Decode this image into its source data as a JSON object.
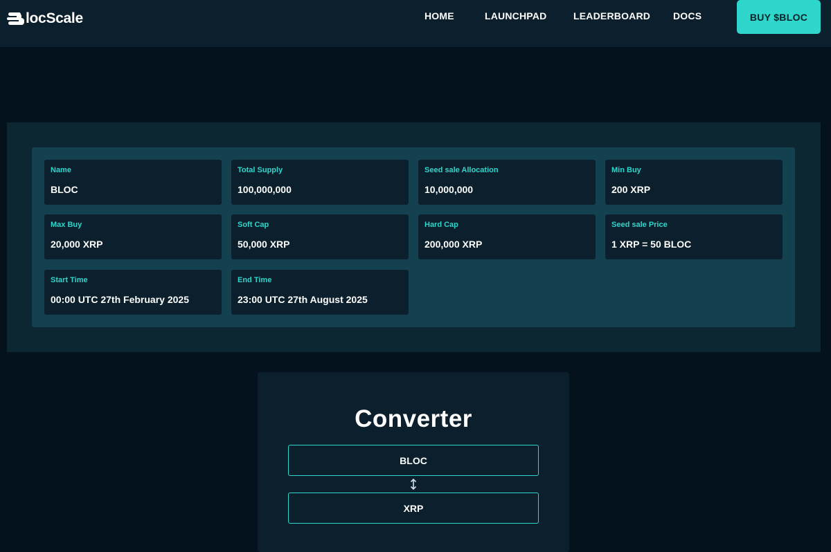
{
  "header": {
    "logo_text": "locScale",
    "nav": {
      "home": "HOME",
      "launchpad": "LAUNCHPAD",
      "leaderboard": "LEADERBOARD",
      "docs": "DOCS"
    },
    "buy_button": "BUY $BLOC"
  },
  "token_info": {
    "items": [
      {
        "label": "Name",
        "value": "BLOC"
      },
      {
        "label": "Total Supply",
        "value": "100,000,000"
      },
      {
        "label": "Seed sale Allocation",
        "value": "10,000,000"
      },
      {
        "label": "Min Buy",
        "value": "200 XRP"
      },
      {
        "label": "Max Buy",
        "value": "20,000 XRP"
      },
      {
        "label": "Soft Cap",
        "value": "50,000 XRP"
      },
      {
        "label": "Hard Cap",
        "value": "200,000 XRP"
      },
      {
        "label": "Seed sale Price",
        "value": "1 XRP = 50 BLOC"
      },
      {
        "label": "Start Time",
        "value": "00:00 UTC 27th February 2025"
      },
      {
        "label": "End Time",
        "value": "23:00 UTC 27th August 2025"
      }
    ]
  },
  "converter": {
    "title": "Converter",
    "from_token": "BLOC",
    "to_token": "XRP",
    "swap_icon": "swap-vertical-icon"
  },
  "colors": {
    "accent": "#2fd6cb",
    "background": "#04121e",
    "navbar": "#0b1f2d",
    "section": "#0c2632",
    "panel": "#144150",
    "card": "#0b1f2d"
  }
}
